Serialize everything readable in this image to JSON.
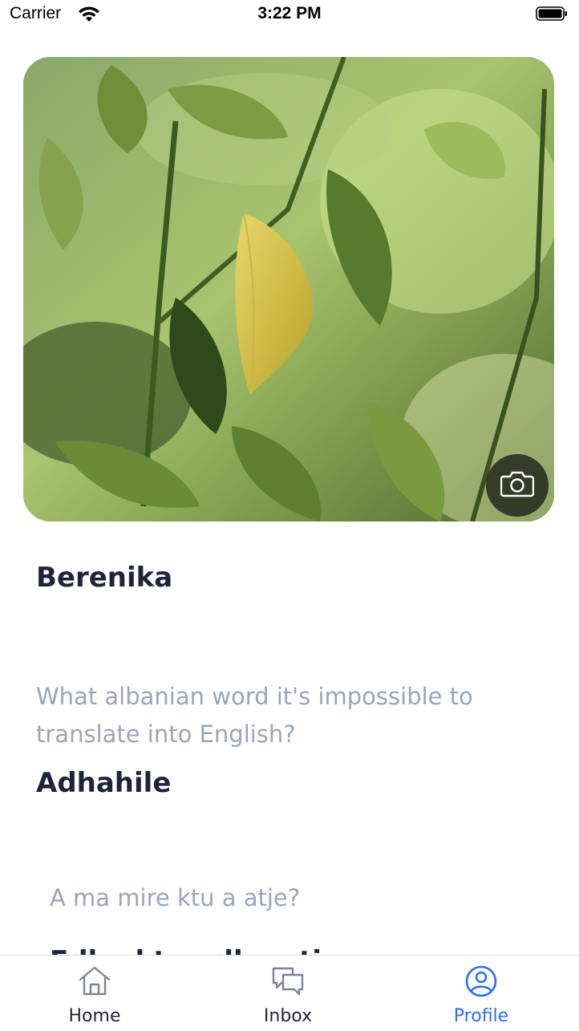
{
  "status_bar": {
    "carrier": "Carrier",
    "time": "3:22 PM"
  },
  "profile": {
    "photo_icon": "leaves-photo",
    "camera_icon": "camera-icon",
    "name": "Berenika"
  },
  "qa": [
    {
      "question": "What albanian word it's impossible to translate into English?",
      "answer": "Adhahile"
    },
    {
      "question": "A ma mire ktu a atje?",
      "answer": "Edhe ktu edhe atje"
    }
  ],
  "tab_bar": {
    "items": [
      {
        "label": "Home",
        "icon": "home-icon"
      },
      {
        "label": "Inbox",
        "icon": "chat-bubbles-icon"
      },
      {
        "label": "Profile",
        "icon": "user-circle-icon"
      }
    ],
    "active": "Profile",
    "accent_color": "#2f6df0"
  }
}
